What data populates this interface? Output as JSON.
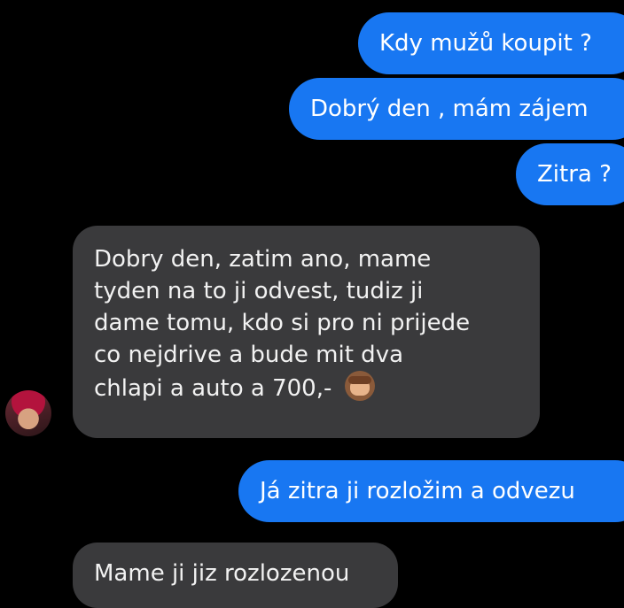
{
  "messages": [
    {
      "direction": "outgoing",
      "text": "Kdy mužů koupit ?"
    },
    {
      "direction": "outgoing",
      "text": "Dobrý den , mám zájem"
    },
    {
      "direction": "outgoing",
      "text": "Zitra ?"
    },
    {
      "direction": "incoming",
      "lines": [
        "Dobry den, zatim ano, mame",
        "tyden na to ji odvest, tudiz ji",
        "dame tomu, kdo si pro ni prijede",
        "co nejdrive a bude mit dva",
        "chlapi a auto a 700,-"
      ],
      "emoji": "see-no-evil-monkey-icon"
    },
    {
      "direction": "outgoing",
      "text": "Já zitra ji rozložim a odvezu"
    },
    {
      "direction": "incoming",
      "text": "Mame ji jiz rozlozenou"
    }
  ],
  "colors": {
    "background": "#000000",
    "outgoing_bubble": "#1877f2",
    "incoming_bubble": "#3a3a3c"
  },
  "sender_avatar_icon": "user-avatar"
}
